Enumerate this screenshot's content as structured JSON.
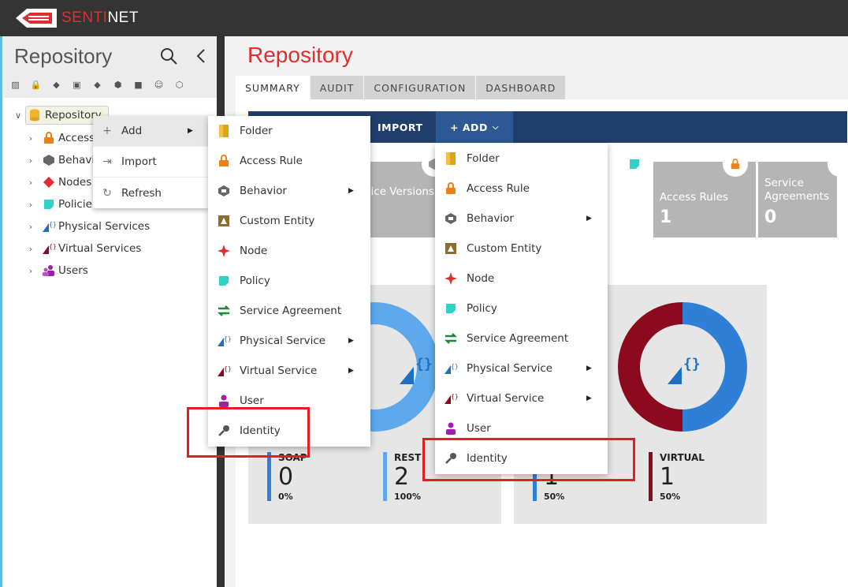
{
  "app": {
    "brand_prefix": "SENTI",
    "brand_suffix": "NET"
  },
  "sidebar": {
    "title": "Repository",
    "tree": {
      "root": "Repository",
      "items": [
        "Access",
        "Behavi",
        "Nodes",
        "Policie",
        "Physical Services",
        "Virtual Services",
        "Users"
      ]
    }
  },
  "context_menu": {
    "items": [
      {
        "label": "Add",
        "icon": "plus-icon"
      },
      {
        "label": "Import",
        "icon": "import-icon"
      },
      {
        "label": "Refresh",
        "icon": "refresh-icon"
      }
    ]
  },
  "add_submenu": {
    "items": [
      "Folder",
      "Access Rule",
      "Behavior",
      "Custom Entity",
      "Node",
      "Policy",
      "Service Agreement",
      "Physical Service",
      "Virtual Service",
      "User",
      "Identity"
    ]
  },
  "main": {
    "title": "Repository",
    "tabs": [
      "SUMMARY",
      "AUDIT",
      "CONFIGURATION",
      "DASHBOARD"
    ],
    "actions": {
      "import": "IMPORT",
      "add": "+ ADD"
    },
    "tiles": [
      {
        "label": "rvice Versions",
        "value": ""
      },
      {
        "label": "Access Rules",
        "value": "1"
      },
      {
        "label": "Service Agreements",
        "value": "0"
      }
    ],
    "physical_stats": [
      {
        "label": "SOAP",
        "value": "0",
        "percent": "0%",
        "color": "#2f7fd6"
      },
      {
        "label": "REST",
        "value": "2",
        "percent": "100%",
        "color": "#5da9ec"
      }
    ],
    "virtual_stats": [
      {
        "label": "",
        "value": "1",
        "percent": "50%",
        "color": "#2f7fd6"
      },
      {
        "label": "VIRTUAL",
        "value": "1",
        "percent": "50%",
        "color": "#8b0a1e"
      }
    ]
  },
  "colors": {
    "brand_red": "#e12d2d",
    "highlight": "#e31e24",
    "nav_dark": "#1f3e6b"
  }
}
